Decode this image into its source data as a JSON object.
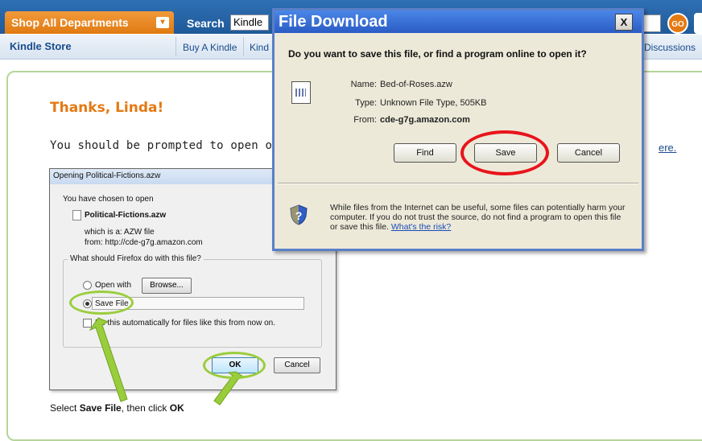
{
  "header": {
    "shop_all": "Shop All Departments",
    "search_label": "Search",
    "search_value": "Kindle",
    "go_label": "GO"
  },
  "subnav": {
    "store": "Kindle Store",
    "links": [
      "Buy A Kindle",
      "Kind",
      "Discussions"
    ]
  },
  "main": {
    "thanks": "Thanks, Linda!",
    "prompt": "You should be prompted to open or",
    "here_link": "ere.",
    "instruction_prefix": "Select",
    "instruction_save": "Save File",
    "instruction_middle": ", then click",
    "instruction_ok": "OK"
  },
  "firefox_dialog": {
    "title": "Opening Political-Fictions.azw",
    "chosen": "You have chosen to open",
    "filename": "Political-Fictions.azw",
    "which_is": "which is a:  AZW file",
    "from": "from:  http://cde-g7g.amazon.com",
    "group_label": "What should Firefox do with this file?",
    "open_with": "Open with",
    "browse": "Browse...",
    "save_file": "Save File",
    "auto_checkbox": "Do this automatically for files like this from now on.",
    "ok": "OK",
    "cancel": "Cancel"
  },
  "ie_dialog": {
    "title": "File Download",
    "close": "X",
    "question": "Do you want to save this file, or find a program online to open it?",
    "name_key": "Name:",
    "name_val": "Bed-of-Roses.azw",
    "type_key": "Type:",
    "type_val": "Unknown File Type, 505KB",
    "from_key": "From:",
    "from_val": "cde-g7g.amazon.com",
    "find": "Find",
    "save": "Save",
    "cancel": "Cancel",
    "warning": "While files from the Internet can be useful, some files can potentially harm your computer. If you do not trust the source, do not find a program to open this file or save this file.",
    "risk_link": "What's the risk?"
  },
  "colors": {
    "header_blue": "#2f6fb3",
    "amazon_orange": "#e47911",
    "annotation_red": "#e8141c",
    "annotation_green": "#9acd3c"
  }
}
